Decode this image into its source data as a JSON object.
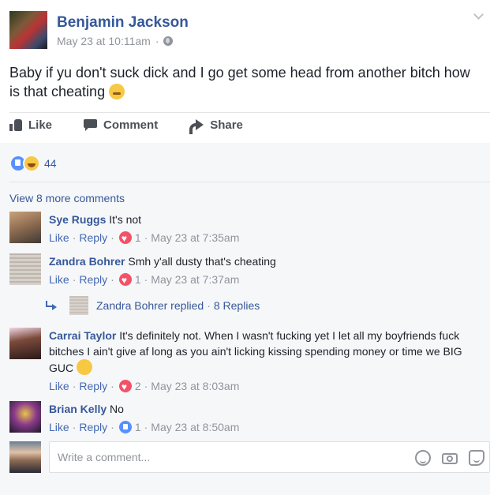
{
  "post": {
    "author": "Benjamin Jackson",
    "timestamp": "May 23 at 10:11am",
    "separator": "·",
    "text": "Baby if yu don't suck dick and I go get some head from another bitch how is that cheating",
    "options_icon": "chevron-down-icon",
    "privacy_icon": "globe-icon"
  },
  "actions": {
    "like": "Like",
    "comment": "Comment",
    "share": "Share"
  },
  "reactions": {
    "count": "44",
    "types": [
      "like",
      "haha"
    ]
  },
  "view_more": "View 8 more comments",
  "comments": [
    {
      "name": "Sye Ruggs",
      "text": "It's not",
      "like": "Like",
      "reply": "Reply",
      "reaction": "heart",
      "reaction_count": "1",
      "time": "May 23 at 7:35am"
    },
    {
      "name": "Zandra Bohrer",
      "text": "Smh y'all dusty that's cheating",
      "like": "Like",
      "reply": "Reply",
      "reaction": "heart",
      "reaction_count": "1",
      "time": "May 23 at 7:37am"
    },
    {
      "name": "Carrai Taylor",
      "text": "It's definitely not. When I wasn't fucking yet I let all my boyfriends fuck bitches I ain't give af long as you ain't licking kissing spending money or time we BIG GUC",
      "like": "Like",
      "reply": "Reply",
      "reaction": "heart",
      "reaction_count": "2",
      "time": "May 23 at 8:03am"
    },
    {
      "name": "Brian Kelly",
      "text": "No",
      "like": "Like",
      "reply": "Reply",
      "reaction": "like",
      "reaction_count": "1",
      "time": "May 23 at 8:50am"
    }
  ],
  "replies": {
    "text": "Zandra Bohrer replied",
    "separator": "·",
    "count": "8 Replies"
  },
  "write_comment": {
    "placeholder": "Write a comment..."
  }
}
